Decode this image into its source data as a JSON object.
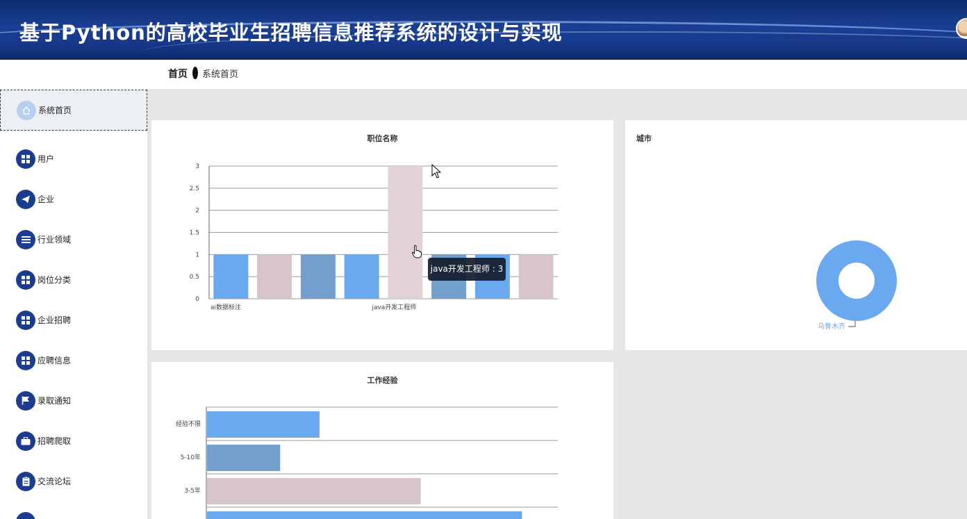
{
  "header": {
    "title": "基于Python的高校毕业生招聘信息推荐系统的设计与实现"
  },
  "breadcrumb": {
    "home": "首页",
    "current": "系统首页"
  },
  "sidebar": {
    "items": [
      {
        "label": "系统首页",
        "icon": "home-icon",
        "active": true
      },
      {
        "label": "用户",
        "icon": "grid-icon"
      },
      {
        "label": "企业",
        "icon": "paper-plane-icon"
      },
      {
        "label": "行业领域",
        "icon": "list-icon"
      },
      {
        "label": "岗位分类",
        "icon": "grid-icon"
      },
      {
        "label": "企业招聘",
        "icon": "grid-icon"
      },
      {
        "label": "应聘信息",
        "icon": "grid-icon"
      },
      {
        "label": "录取通知",
        "icon": "flag-icon"
      },
      {
        "label": "招聘爬取",
        "icon": "briefcase-icon"
      },
      {
        "label": "交流论坛",
        "icon": "clipboard-icon"
      }
    ]
  },
  "colors": {
    "blue": "#6aa9f0",
    "pink": "#e3d1d8",
    "steel": "#739fcf",
    "rose": "#d8c5cb",
    "header": "#1a3f94"
  },
  "panels": {
    "job": "职位名称",
    "city": "城市",
    "exp": "工作经验"
  },
  "tooltip": {
    "text": "java开发工程师 : 3"
  },
  "chart_data": [
    {
      "type": "bar",
      "title": "职位名称",
      "category_labels_shown": [
        "ai数据标注",
        "java开发工程师"
      ],
      "values": [
        1,
        1,
        1,
        1,
        3,
        1,
        1,
        1
      ],
      "bar_colors": [
        "#6aa9f0",
        "#d8c5cb",
        "#739fcf",
        "#6aa9f0",
        "#e3d1d8",
        "#739fcf",
        "#6aa9f0",
        "#d8c5cb"
      ],
      "yticks": [
        "0",
        "0.5",
        "1",
        "1.5",
        "2",
        "2.5",
        "3"
      ],
      "ylim": [
        0,
        3
      ]
    },
    {
      "type": "pie",
      "title": "城市",
      "labels": [
        "乌鲁木齐"
      ],
      "values": [
        1
      ],
      "colors": [
        "#6aa9f0"
      ]
    },
    {
      "type": "bar",
      "orientation": "horizontal",
      "title": "工作经验",
      "categories": [
        "经验不限",
        "5-10年",
        "3-5年"
      ],
      "values": [
        2,
        1.3,
        3.8,
        5.6
      ],
      "bar_colors": [
        "#6aa9f0",
        "#739fcf",
        "#d8c5cb",
        "#6aa9f0"
      ]
    }
  ]
}
